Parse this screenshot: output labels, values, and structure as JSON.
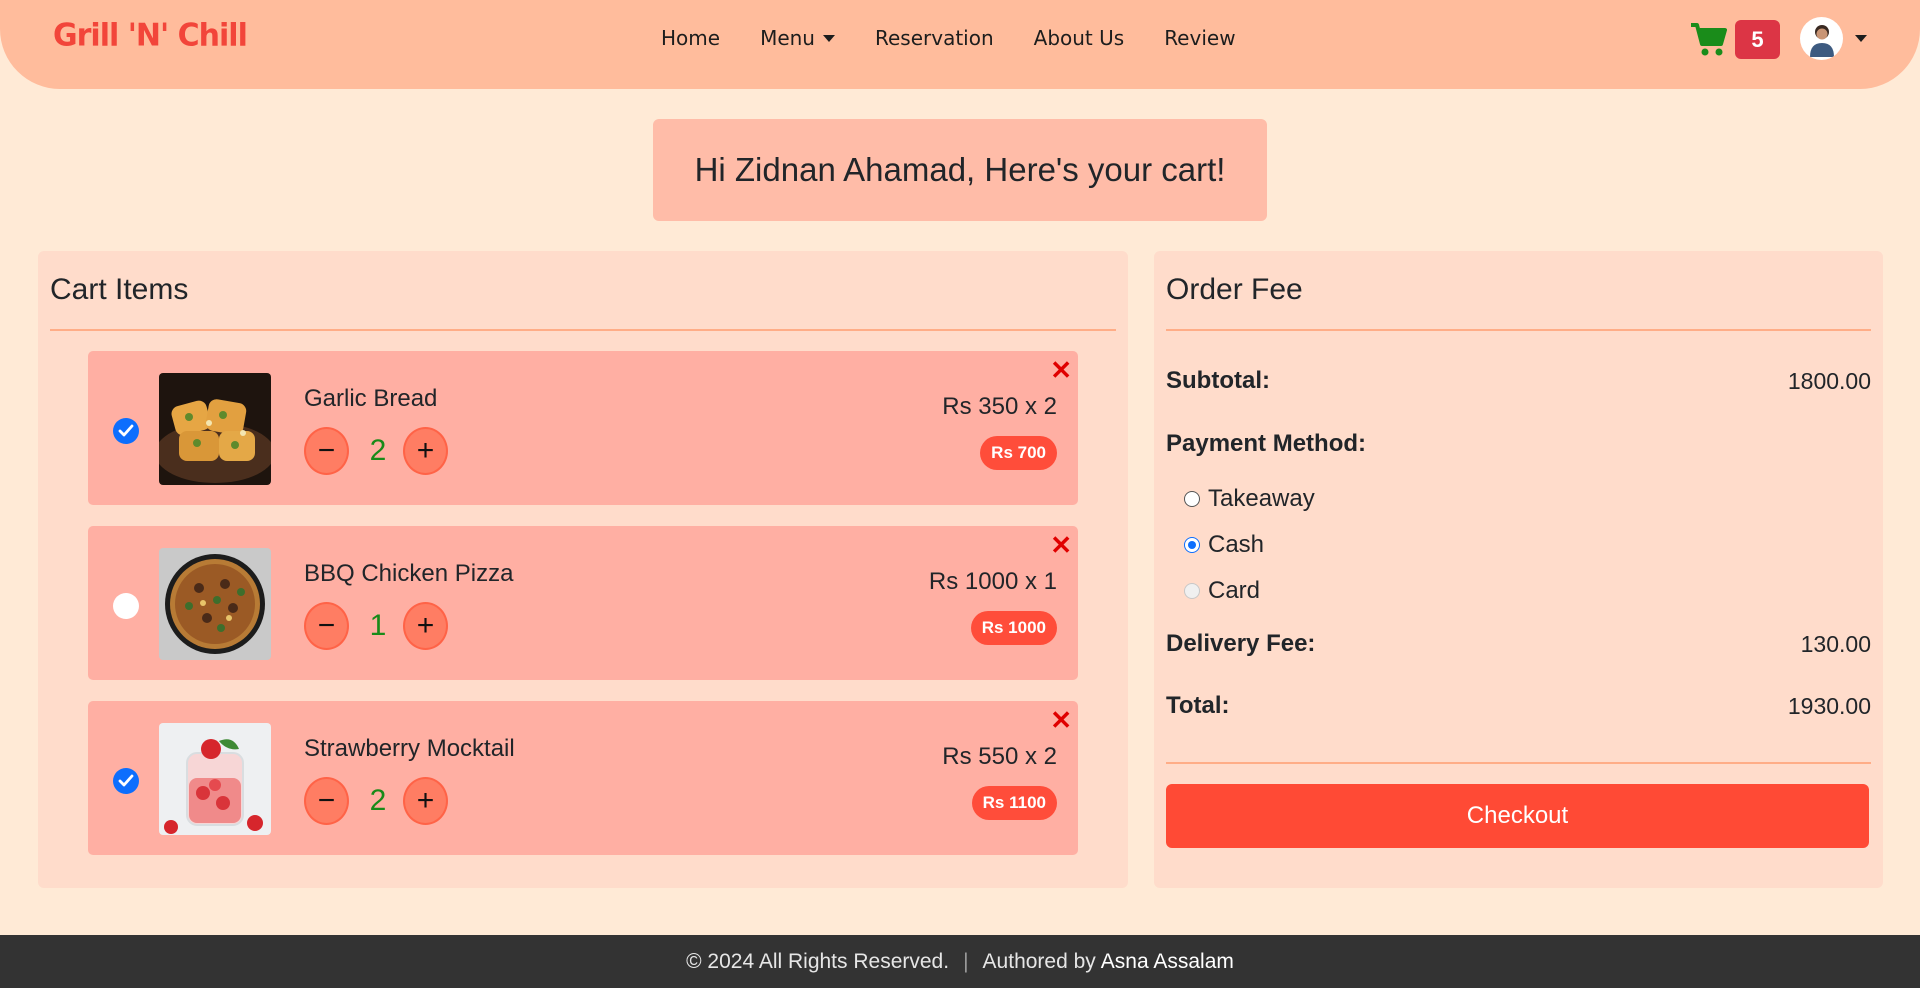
{
  "navbar": {
    "brand": "Grill 'N' Chill",
    "links": [
      "Home",
      "Menu",
      "Reservation",
      "About Us",
      "Review"
    ],
    "cart_count": "5",
    "icons": {
      "cart": "cart-icon",
      "avatar": "user-avatar"
    },
    "colors": {
      "brand": "#f2453a",
      "badge": "#dc3545",
      "cart": "#1a8c1a"
    }
  },
  "greeting": "Hi Zidnan Ahamad, Here's your cart!",
  "cart": {
    "title": "Cart Items",
    "items": [
      {
        "name": "Garlic Bread",
        "qty": "2",
        "price": "Rs 350 x 2",
        "total": "Rs 700",
        "selected": true,
        "image": "garlic-bread-photo"
      },
      {
        "name": "BBQ Chicken Pizza",
        "qty": "1",
        "price": "Rs 1000 x 1",
        "total": "Rs 1000",
        "selected": false,
        "image": "pizza-photo"
      },
      {
        "name": "Strawberry Mocktail",
        "qty": "2",
        "price": "Rs 550 x 2",
        "total": "Rs 1100",
        "selected": true,
        "image": "mocktail-photo"
      }
    ],
    "minus": "−",
    "plus": "+",
    "remove": "✕"
  },
  "order": {
    "title": "Order Fee",
    "subtotal_label": "Subtotal:",
    "subtotal_value": "1800.00",
    "payment_label": "Payment Method:",
    "payment_options": [
      {
        "label": "Takeaway",
        "state": "unchecked"
      },
      {
        "label": "Cash",
        "state": "checked"
      },
      {
        "label": "Card",
        "state": "disabled"
      }
    ],
    "delivery_label": "Delivery Fee:",
    "delivery_value": "130.00",
    "total_label": "Total:",
    "total_value": "1930.00",
    "checkout": "Checkout"
  },
  "footer": {
    "copyright": "© 2024 All Rights Reserved.",
    "separator": "|",
    "authored_by": "Authored by",
    "author": "Asna Assalam"
  }
}
